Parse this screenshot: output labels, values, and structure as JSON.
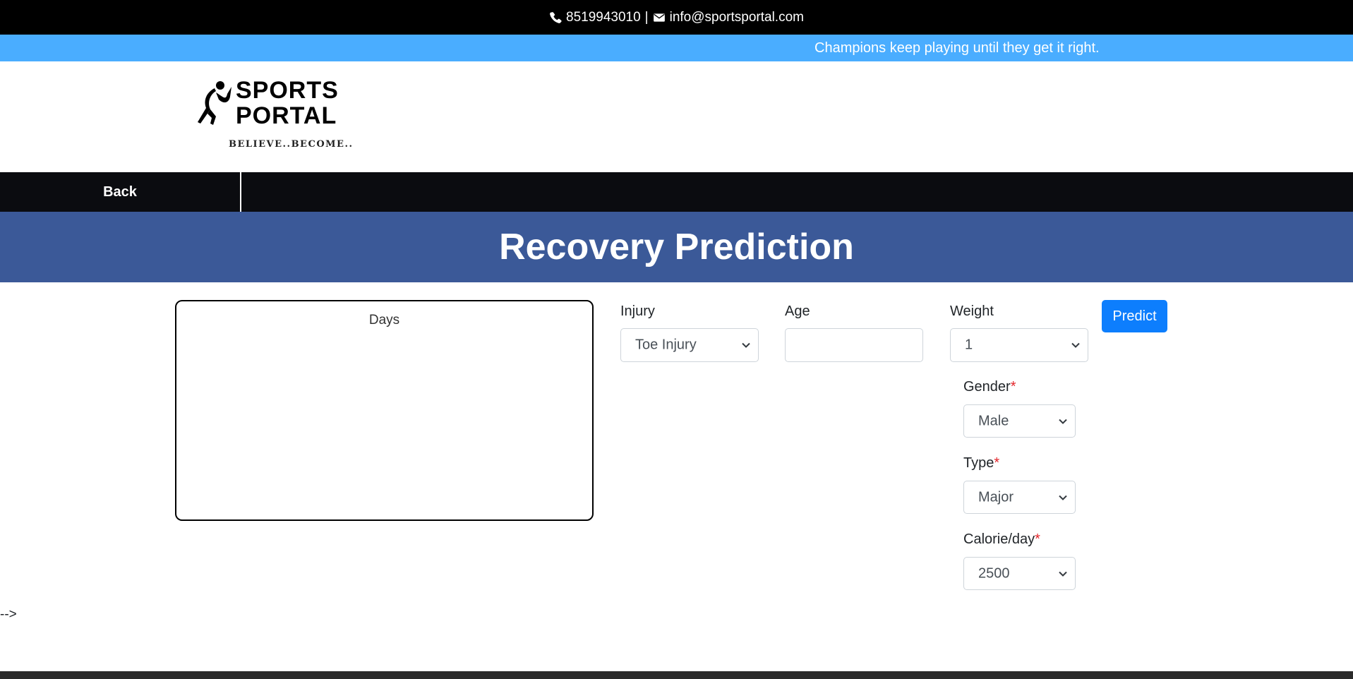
{
  "contact": {
    "phone": "8519943010",
    "separator": "|",
    "email": "info@sportsportal.com"
  },
  "tagline": "Champions keep playing until they get it right.",
  "logo": {
    "line1": "SPORTS",
    "line2": "PORTAL",
    "slogan": "BELIEVE..BECOME.."
  },
  "nav": {
    "back_label": "Back"
  },
  "page_title": "Recovery Prediction",
  "chart": {
    "title": "Days"
  },
  "form": {
    "injury": {
      "label": "Injury",
      "value": "Toe Injury"
    },
    "age": {
      "label": "Age",
      "value": ""
    },
    "weight": {
      "label": "Weight",
      "value": "1"
    },
    "gender": {
      "label": "Gender",
      "value": "Male"
    },
    "type": {
      "label": "Type",
      "value": "Major"
    },
    "calorie": {
      "label": "Calorie/day",
      "value": "2500"
    },
    "required_mark": "*"
  },
  "predict_label": "Predict",
  "stray_text": "-->"
}
